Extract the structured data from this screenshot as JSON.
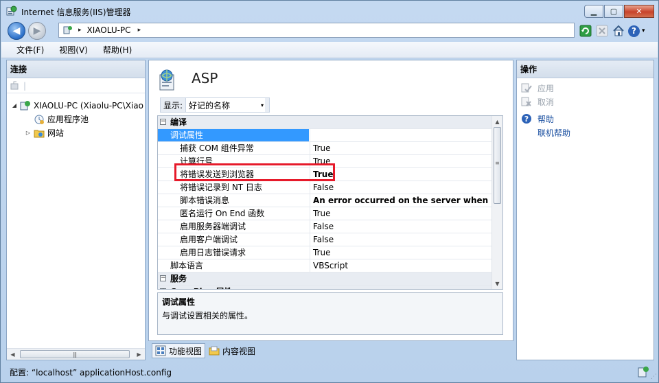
{
  "window": {
    "title": "Internet 信息服务(IIS)管理器",
    "minimize_glyph": "▁",
    "maximize_glyph": "▢",
    "close_glyph": "✕"
  },
  "navigation": {
    "back_glyph": "◀",
    "forward_glyph": "▶",
    "address_separator": "▸",
    "address_path": "XIAOLU-PC",
    "address_trailing": "▸",
    "help_glyph": "?",
    "help_caret": "▾"
  },
  "menu": {
    "items": [
      "文件(F)",
      "视图(V)",
      "帮助(H)"
    ]
  },
  "connections": {
    "header": "连接",
    "toolbar_sep": "|",
    "tree": [
      {
        "label": "XIAOLU-PC (Xiaolu-PC\\Xiao",
        "expander": "◢",
        "level": 0
      },
      {
        "label": "应用程序池",
        "expander": "",
        "level": 1
      },
      {
        "label": "网站",
        "expander": "▷",
        "level": 1
      }
    ],
    "scroll_left": "◀",
    "scroll_right": "▶",
    "scroll_grip": "|||"
  },
  "feature": {
    "title": "ASP",
    "display_label": "显示:",
    "display_value": "好记的名称",
    "display_caret": "▾"
  },
  "properties": {
    "rows": [
      {
        "type": "cat",
        "name": "编译",
        "box": "−"
      },
      {
        "type": "cat-selected",
        "name": "调试属性",
        "box": "−"
      },
      {
        "type": "prop",
        "name": "捕获 COM 组件异常",
        "value": "True",
        "bold": false,
        "indent": 2
      },
      {
        "type": "prop",
        "name": "计算行号",
        "value": "True",
        "bold": false,
        "indent": 2
      },
      {
        "type": "prop",
        "name": "将错误发送到浏览器",
        "value": "True",
        "bold": true,
        "indent": 2
      },
      {
        "type": "prop",
        "name": "将错误记录到 NT 日志",
        "value": "False",
        "bold": false,
        "indent": 2
      },
      {
        "type": "prop",
        "name": "脚本错误消息",
        "value": "An error occurred on the server when proc",
        "bold": true,
        "indent": 2
      },
      {
        "type": "prop",
        "name": "匿名运行 On End 函数",
        "value": "True",
        "bold": false,
        "indent": 2
      },
      {
        "type": "prop",
        "name": "启用服务器端调试",
        "value": "False",
        "bold": false,
        "indent": 2
      },
      {
        "type": "prop",
        "name": "启用客户端调试",
        "value": "False",
        "bold": false,
        "indent": 2
      },
      {
        "type": "prop",
        "name": "启用日志错误请求",
        "value": "True",
        "bold": false,
        "indent": 2
      },
      {
        "type": "prop",
        "name": "脚本语言",
        "value": "VBScript",
        "bold": false,
        "indent": 1
      },
      {
        "type": "cat",
        "name": "服务",
        "box": "−"
      },
      {
        "type": "cat-partial",
        "name": "Com Plus 属性",
        "box": "+"
      }
    ],
    "scroll_up": "▲",
    "scroll_down": "▼",
    "scroll_grip": "≡"
  },
  "description": {
    "title": "调试属性",
    "text": "与调试设置相关的属性。"
  },
  "view_tabs": [
    {
      "label": "功能视图",
      "active": true
    },
    {
      "label": "内容视图",
      "active": false
    }
  ],
  "actions": {
    "header": "操作",
    "items": [
      {
        "label": "应用",
        "state": "disabled",
        "icon": "apply-icon"
      },
      {
        "label": "取消",
        "state": "disabled",
        "icon": "cancel-icon"
      },
      {
        "label": "帮助",
        "state": "link",
        "icon": "help-icon"
      },
      {
        "label": "联机帮助",
        "state": "link",
        "icon": ""
      }
    ]
  },
  "status": {
    "text": "配置: “localhost” applicationHost.config",
    "grip": "⋰"
  },
  "colors": {
    "selection": "#3399ff",
    "highlight_box": "#e61a2a",
    "link": "#1a4fa0"
  }
}
